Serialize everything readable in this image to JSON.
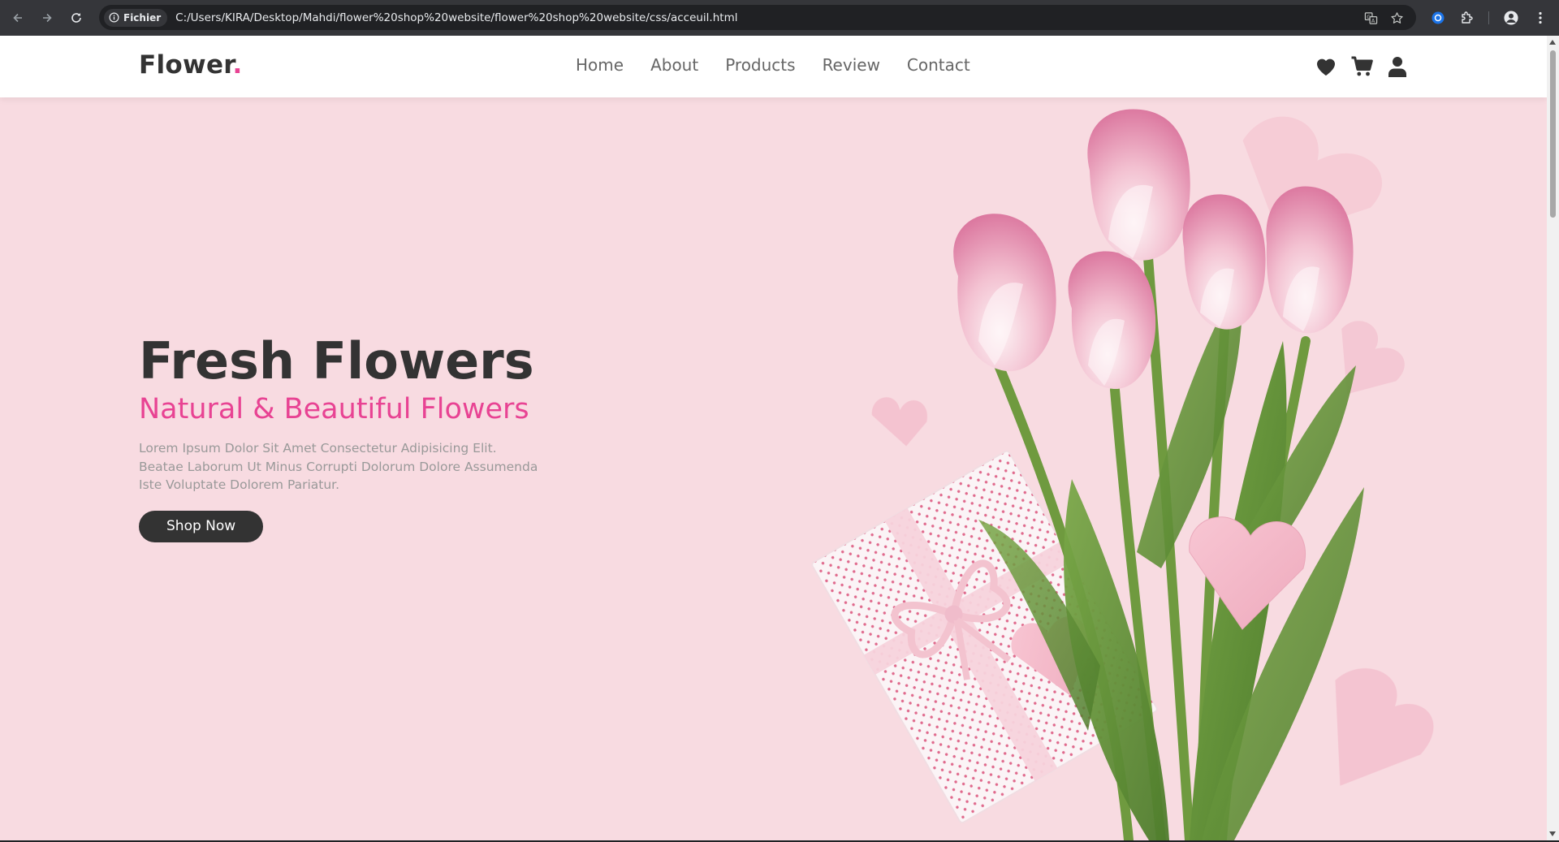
{
  "browser": {
    "site_chip_label": "Fichier",
    "url": "C:/Users/KIRA/Desktop/Mahdi/flower%20shop%20website/flower%20shop%20website/css/acceuil.html"
  },
  "header": {
    "logo_text": "Flower",
    "logo_dot": ".",
    "nav": [
      {
        "label": "Home"
      },
      {
        "label": "About"
      },
      {
        "label": "Products"
      },
      {
        "label": "Review"
      },
      {
        "label": "Contact"
      }
    ],
    "icons": [
      "heart-icon",
      "cart-icon",
      "user-icon"
    ]
  },
  "hero": {
    "title": "Fresh Flowers",
    "subtitle": "Natural & Beautiful Flowers",
    "description": "Lorem Ipsum Dolor Sit Amet Consectetur Adipisicing Elit. Beatae Laborum Ut Minus Corrupti Dolorum Dolore Assumenda Iste Voluptate Dolorem Pariatur.",
    "button_label": "Shop Now"
  },
  "colors": {
    "accent": "#e84393",
    "dark": "#333333",
    "hero_bg": "#f8dbe1"
  }
}
